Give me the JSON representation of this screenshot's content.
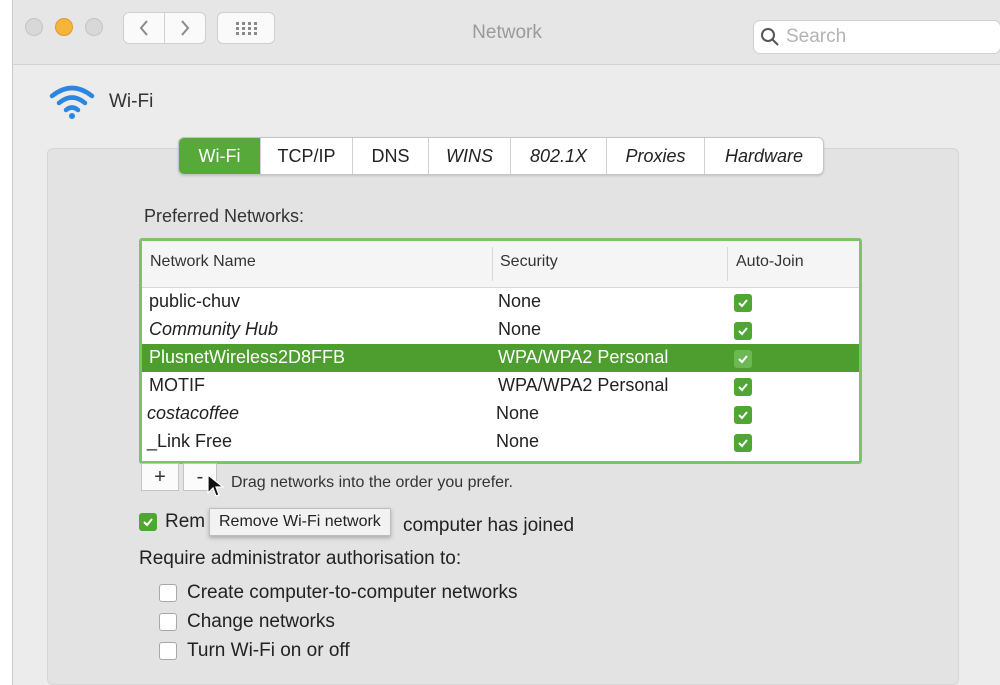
{
  "window": {
    "title": "Network",
    "search_placeholder": "Search",
    "traffic_lights": {
      "close": "#d8d8d8",
      "minimize": "#f5b43a",
      "zoom": "#d8d8d8"
    }
  },
  "interface": {
    "icon": "wifi-icon",
    "name": "Wi-Fi",
    "icon_color": "#2a86e0"
  },
  "tabs": [
    {
      "label": "Wi-Fi",
      "active": true
    },
    {
      "label": "TCP/IP",
      "active": false
    },
    {
      "label": "DNS",
      "active": false
    },
    {
      "label": "WINS",
      "active": false
    },
    {
      "label": "802.1X",
      "active": false
    },
    {
      "label": "Proxies",
      "active": false
    },
    {
      "label": "Hardware",
      "active": false
    }
  ],
  "preferred_networks": {
    "label": "Preferred Networks:",
    "columns": {
      "name": "Network Name",
      "security": "Security",
      "auto_join": "Auto-Join"
    },
    "rows": [
      {
        "name": "public-chuv",
        "security": "None",
        "auto_join": true,
        "selected": false
      },
      {
        "name": "Community Hub",
        "security": "None",
        "auto_join": true,
        "selected": false
      },
      {
        "name": "PlusnetWireless2D8FFB",
        "security": "WPA/WPA2 Personal",
        "auto_join": true,
        "selected": true
      },
      {
        "name": "MOTIF",
        "security": "WPA/WPA2 Personal",
        "auto_join": true,
        "selected": false
      },
      {
        "name": "costacoffee",
        "security": "None",
        "auto_join": true,
        "selected": false
      },
      {
        "name": "_Link Free",
        "security": "None",
        "auto_join": true,
        "selected": false
      }
    ],
    "add_label": "+",
    "remove_label": "-",
    "hint": "Drag networks into the order you prefer."
  },
  "remember": {
    "label_start": "Rem",
    "label_end": "computer has joined",
    "checked": true
  },
  "tooltip": "Remove Wi-Fi network",
  "require_admin": {
    "label": "Require administrator authorisation to:",
    "options": [
      {
        "label": "Create computer-to-computer networks",
        "checked": false
      },
      {
        "label": "Change networks",
        "checked": false
      },
      {
        "label": "Turn Wi-Fi on or off",
        "checked": false
      }
    ]
  },
  "colors": {
    "accent_green": "#57a93a",
    "selected_row": "#4e9d2f",
    "focus_ring": "#7cc467"
  }
}
